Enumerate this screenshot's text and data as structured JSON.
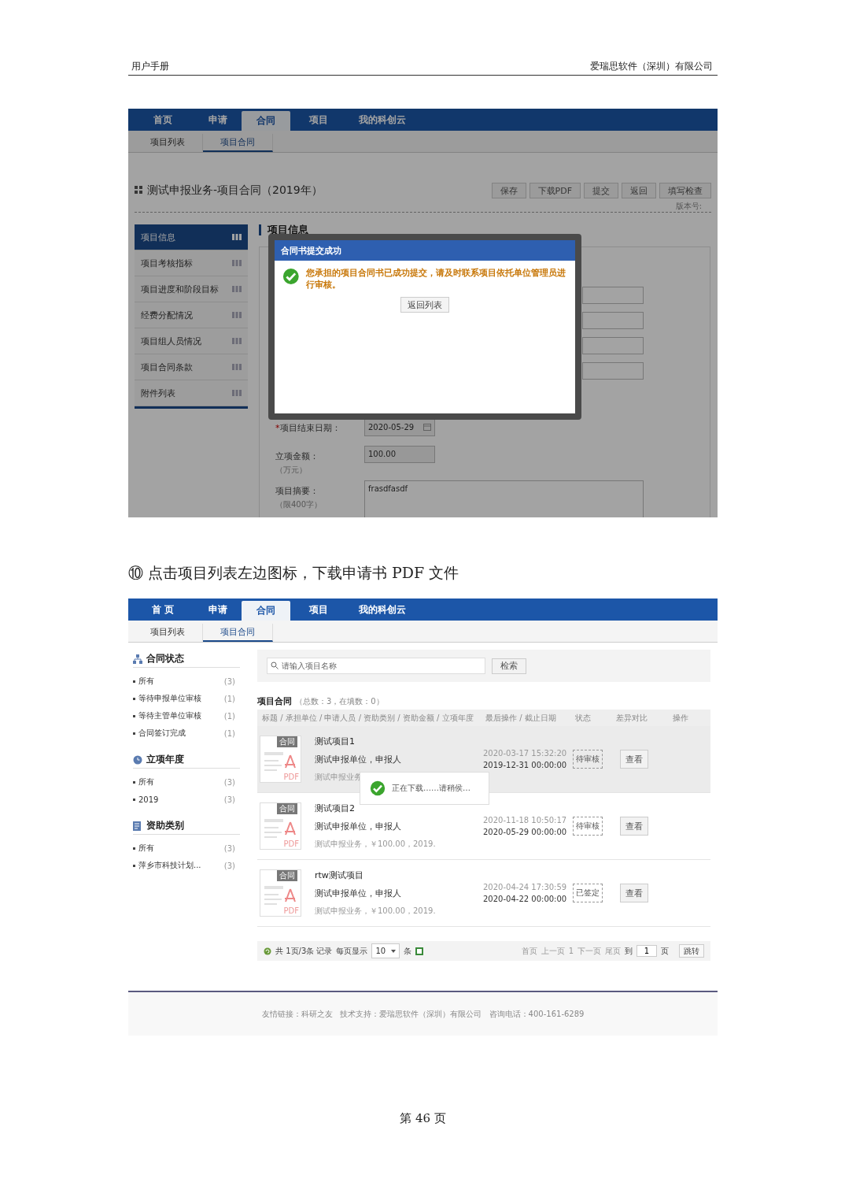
{
  "doc_header": {
    "left": "用户手册",
    "right": "爱瑞思软件（深圳）有限公司"
  },
  "screenshot_1": {
    "nav": [
      {
        "label": "首页",
        "selected": false
      },
      {
        "label": "申请",
        "selected": false
      },
      {
        "label": "合同",
        "selected": true
      },
      {
        "label": "项目",
        "selected": false
      },
      {
        "label": "我的科创云",
        "selected": false
      }
    ],
    "subnav": [
      {
        "label": "项目列表",
        "selected": false
      },
      {
        "label": "项目合同",
        "selected": true
      }
    ],
    "title": "测试申报业务-项目合同（2019年）",
    "buttons": [
      "保存",
      "下载PDF",
      "提交",
      "返回",
      "填写检查"
    ],
    "version_label": "版本号:",
    "side_menu": [
      {
        "label": "项目信息",
        "selected": true
      },
      {
        "label": "项目考核指标",
        "selected": false
      },
      {
        "label": "项目进度和阶段目标",
        "selected": false
      },
      {
        "label": "经费分配情况",
        "selected": false
      },
      {
        "label": "项目组人员情况",
        "selected": false
      },
      {
        "label": "项目合同条款",
        "selected": false
      },
      {
        "label": "附件列表",
        "selected": false
      }
    ],
    "section_title": "项目信息",
    "required_mark": "*",
    "form": [
      {
        "kind": "date",
        "required": true,
        "label": "项目结束日期：",
        "value": "2020-05-29"
      },
      {
        "kind": "text",
        "required": false,
        "label": "立项金额：",
        "note": "（万元）",
        "value": "100.00"
      },
      {
        "kind": "textarea",
        "required": false,
        "label": "项目摘要：",
        "note": "（限400字）",
        "value": "frasdfasdf"
      }
    ],
    "dialog": {
      "title": "合同书提交成功",
      "message": "您承担的项目合同书已成功提交，请及时联系项目依托单位管理员进行审核。",
      "button": "返回列表"
    }
  },
  "caption": "⑩ 点击项目列表左边图标，下载申请书 PDF 文件",
  "screenshot_2": {
    "nav": [
      {
        "label": "首 页",
        "selected": false
      },
      {
        "label": "申请",
        "selected": false
      },
      {
        "label": "合同",
        "selected": true
      },
      {
        "label": "项目",
        "selected": false
      },
      {
        "label": "我的科创云",
        "selected": false
      }
    ],
    "subnav": [
      {
        "label": "项目列表",
        "selected": false
      },
      {
        "label": "项目合同",
        "selected": true
      }
    ],
    "filters": [
      {
        "kind": "org",
        "title": "合同状态",
        "items": [
          {
            "label": "所有",
            "count": "(3)"
          },
          {
            "label": "等待申报单位审核",
            "count": "(1)"
          },
          {
            "label": "等待主管单位审核",
            "count": "(1)"
          },
          {
            "label": "合同签订完成",
            "count": "(1)"
          }
        ]
      },
      {
        "kind": "clock",
        "title": "立项年度",
        "items": [
          {
            "label": "所有",
            "count": "(3)"
          },
          {
            "label": "2019",
            "count": "(3)"
          }
        ]
      },
      {
        "kind": "list",
        "title": "资助类别",
        "items": [
          {
            "label": "所有",
            "count": "(3)"
          },
          {
            "label": "萍乡市科技计划...",
            "count": "(3)"
          }
        ]
      }
    ],
    "search": {
      "placeholder": "请输入项目名称",
      "button": "检索"
    },
    "list_title": "项目合同",
    "list_summary": "（总数：3，在填数：0）",
    "columns": [
      "标题 / 承担单位 / 申请人员 / 资助类别 / 资助金额 / 立项年度",
      "最后操作 / 截止日期",
      "状态",
      "差异对比",
      "操作"
    ],
    "rows": [
      {
        "tag": "合同",
        "file_type": "PDF",
        "title": "测试项目1",
        "unit": "测试申报单位，申报人",
        "detail": "测试申报业务",
        "last_action": "2020-03-17 15:32:20",
        "deadline": "2019-12-31 00:00:00",
        "status": "待审核",
        "action": "查看",
        "selected": true
      },
      {
        "tag": "合同",
        "file_type": "PDF",
        "title": "测试项目2",
        "unit": "测试申报单位，申报人",
        "detail": "测试申报业务，￥100.00，2019.",
        "last_action": "2020-11-18 10:50:17",
        "deadline": "2020-05-29 00:00:00",
        "status": "待审核",
        "action": "查看",
        "selected": false
      },
      {
        "tag": "合同",
        "file_type": "PDF",
        "title": "rtw测试项目",
        "unit": "测试申报单位，申报人",
        "detail": "测试申报业务，￥100.00，2019.",
        "last_action": "2020-04-24 17:30:59",
        "deadline": "2020-04-22 00:00:00",
        "status": "已签定",
        "action": "查看",
        "selected": false
      }
    ],
    "toast": "正在下载……请稍侯…",
    "pager": {
      "summary": "共 1页/3条 记录",
      "per_page_label": "每页显示",
      "per_page": "10",
      "unit": "条",
      "links": [
        "首页",
        "上一页",
        "1",
        "下一页",
        "尾页"
      ],
      "goto_label": "到",
      "page": "1",
      "page_unit": "页",
      "jump": "跳转"
    },
    "footer": "友情链接：科研之友   技术支持：爱瑞思软件（深圳）有限公司   咨询电话：400-161-6289"
  },
  "page_number": "第 46 页"
}
